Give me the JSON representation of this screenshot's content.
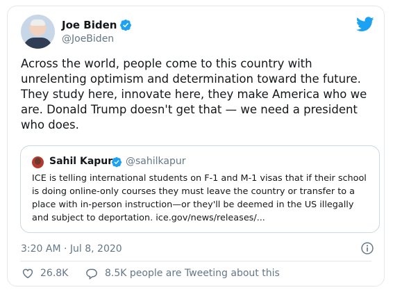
{
  "author": {
    "name": "Joe Biden",
    "handle": "@JoeBiden",
    "verified_icon": "verified-badge-icon",
    "avatar": "avatar"
  },
  "tweet": {
    "text": "Across the world, people come to this country with\nunrelenting optimism and determination toward the future.\nThey study here, innovate here, they make America who we\nare. Donald Trump doesn't get that — we need a president\nwho does."
  },
  "quoted_tweet": {
    "name": "Sahil Kapur",
    "handle": "@sahilkapur",
    "text": "ICE is telling international students on F-1 and M-1 visas that if their school\nis doing online-only courses they must leave the country or transfer to a\nplace with in-person instruction—or they'll be deemed in the US illegally\nand subject to deportation. ice.gov/news/releases/..."
  },
  "meta": {
    "timestamp": "3:20 AM · Jul 8, 2020"
  },
  "actions": {
    "likes": "26.8K",
    "discussion": "8.5K people are Tweeting about this"
  },
  "colors": {
    "brand": "#1da1f2",
    "text": "#14171a",
    "secondary": "#657786",
    "like": "#e0245e"
  },
  "icons": {
    "brand": "twitter-bird-icon",
    "info": "info-icon",
    "like": "heart-icon",
    "reply": "reply-bubble-icon"
  }
}
